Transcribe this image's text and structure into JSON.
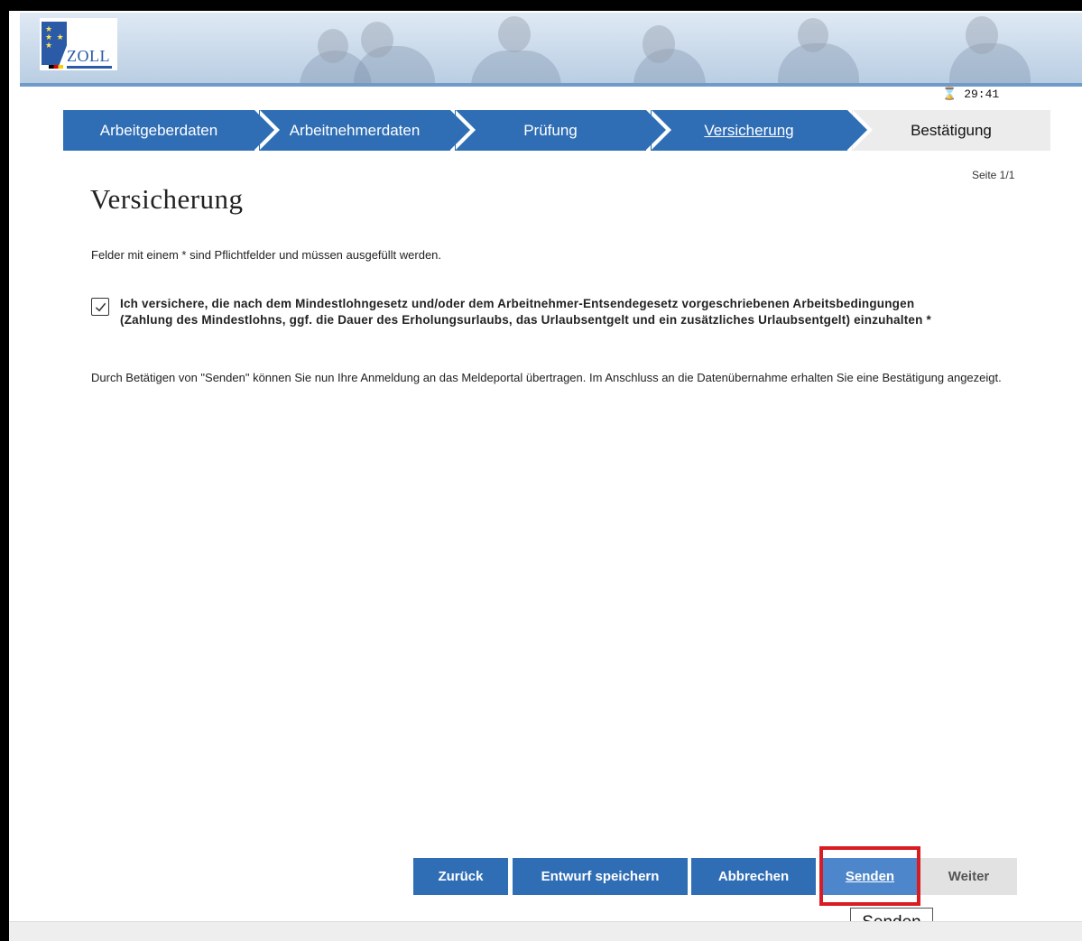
{
  "header": {
    "logo_text": "ZOLL",
    "timer": "29:41"
  },
  "steps": [
    {
      "label": "Arbeitgeberdaten",
      "state": "done"
    },
    {
      "label": "Arbeitnehmerdaten",
      "state": "done"
    },
    {
      "label": "Prüfung",
      "state": "done"
    },
    {
      "label": "Versicherung",
      "state": "active"
    },
    {
      "label": "Bestätigung",
      "state": "todo"
    }
  ],
  "page_indicator": "Seite 1/1",
  "title": "Versicherung",
  "required_hint": "Felder mit einem * sind Pflichtfelder und müssen ausgefüllt werden.",
  "confirmation": {
    "checked": true,
    "text": "Ich versichere, die nach dem Mindestlohngesetz und/oder dem Arbeitnehmer-Entsendegesetz vorgeschriebenen Arbeitsbedingungen (Zahlung des Mindestlohns, ggf. die Dauer des Erholungsurlaubs, das Urlaubsentgelt und ein zusätzliches Urlaubsentgelt) einzuhalten *"
  },
  "info_text": "Durch Betätigen von \"Senden\" können Sie nun Ihre Anmeldung an das Meldeportal übertragen. Im Anschluss an die Datenübernahme erhalten Sie eine Bestätigung angezeigt.",
  "buttons": {
    "back": "Zurück",
    "save_draft": "Entwurf speichern",
    "cancel": "Abbrechen",
    "send": "Senden",
    "next": "Weiter"
  },
  "tooltip": "Senden",
  "colors": {
    "primary": "#2f6eb5",
    "send_hover": "#4d86cb",
    "highlight": "#d81c22"
  }
}
